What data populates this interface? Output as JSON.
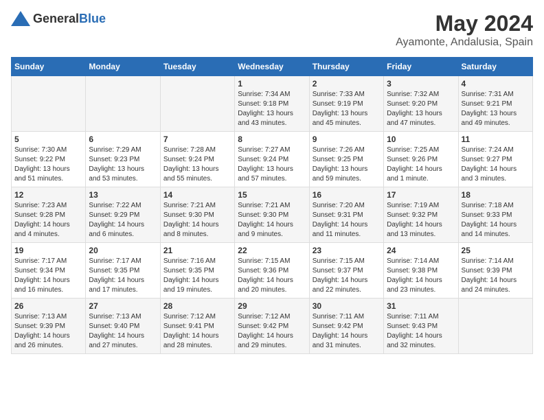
{
  "header": {
    "logo_general": "General",
    "logo_blue": "Blue",
    "title": "May 2024",
    "subtitle": "Ayamonte, Andalusia, Spain"
  },
  "weekdays": [
    "Sunday",
    "Monday",
    "Tuesday",
    "Wednesday",
    "Thursday",
    "Friday",
    "Saturday"
  ],
  "rows": [
    [
      {
        "day": "",
        "sunrise": "",
        "sunset": "",
        "daylight": ""
      },
      {
        "day": "",
        "sunrise": "",
        "sunset": "",
        "daylight": ""
      },
      {
        "day": "",
        "sunrise": "",
        "sunset": "",
        "daylight": ""
      },
      {
        "day": "1",
        "sunrise": "Sunrise: 7:34 AM",
        "sunset": "Sunset: 9:18 PM",
        "daylight": "Daylight: 13 hours and 43 minutes."
      },
      {
        "day": "2",
        "sunrise": "Sunrise: 7:33 AM",
        "sunset": "Sunset: 9:19 PM",
        "daylight": "Daylight: 13 hours and 45 minutes."
      },
      {
        "day": "3",
        "sunrise": "Sunrise: 7:32 AM",
        "sunset": "Sunset: 9:20 PM",
        "daylight": "Daylight: 13 hours and 47 minutes."
      },
      {
        "day": "4",
        "sunrise": "Sunrise: 7:31 AM",
        "sunset": "Sunset: 9:21 PM",
        "daylight": "Daylight: 13 hours and 49 minutes."
      }
    ],
    [
      {
        "day": "5",
        "sunrise": "Sunrise: 7:30 AM",
        "sunset": "Sunset: 9:22 PM",
        "daylight": "Daylight: 13 hours and 51 minutes."
      },
      {
        "day": "6",
        "sunrise": "Sunrise: 7:29 AM",
        "sunset": "Sunset: 9:23 PM",
        "daylight": "Daylight: 13 hours and 53 minutes."
      },
      {
        "day": "7",
        "sunrise": "Sunrise: 7:28 AM",
        "sunset": "Sunset: 9:24 PM",
        "daylight": "Daylight: 13 hours and 55 minutes."
      },
      {
        "day": "8",
        "sunrise": "Sunrise: 7:27 AM",
        "sunset": "Sunset: 9:24 PM",
        "daylight": "Daylight: 13 hours and 57 minutes."
      },
      {
        "day": "9",
        "sunrise": "Sunrise: 7:26 AM",
        "sunset": "Sunset: 9:25 PM",
        "daylight": "Daylight: 13 hours and 59 minutes."
      },
      {
        "day": "10",
        "sunrise": "Sunrise: 7:25 AM",
        "sunset": "Sunset: 9:26 PM",
        "daylight": "Daylight: 14 hours and 1 minute."
      },
      {
        "day": "11",
        "sunrise": "Sunrise: 7:24 AM",
        "sunset": "Sunset: 9:27 PM",
        "daylight": "Daylight: 14 hours and 3 minutes."
      }
    ],
    [
      {
        "day": "12",
        "sunrise": "Sunrise: 7:23 AM",
        "sunset": "Sunset: 9:28 PM",
        "daylight": "Daylight: 14 hours and 4 minutes."
      },
      {
        "day": "13",
        "sunrise": "Sunrise: 7:22 AM",
        "sunset": "Sunset: 9:29 PM",
        "daylight": "Daylight: 14 hours and 6 minutes."
      },
      {
        "day": "14",
        "sunrise": "Sunrise: 7:21 AM",
        "sunset": "Sunset: 9:30 PM",
        "daylight": "Daylight: 14 hours and 8 minutes."
      },
      {
        "day": "15",
        "sunrise": "Sunrise: 7:21 AM",
        "sunset": "Sunset: 9:30 PM",
        "daylight": "Daylight: 14 hours and 9 minutes."
      },
      {
        "day": "16",
        "sunrise": "Sunrise: 7:20 AM",
        "sunset": "Sunset: 9:31 PM",
        "daylight": "Daylight: 14 hours and 11 minutes."
      },
      {
        "day": "17",
        "sunrise": "Sunrise: 7:19 AM",
        "sunset": "Sunset: 9:32 PM",
        "daylight": "Daylight: 14 hours and 13 minutes."
      },
      {
        "day": "18",
        "sunrise": "Sunrise: 7:18 AM",
        "sunset": "Sunset: 9:33 PM",
        "daylight": "Daylight: 14 hours and 14 minutes."
      }
    ],
    [
      {
        "day": "19",
        "sunrise": "Sunrise: 7:17 AM",
        "sunset": "Sunset: 9:34 PM",
        "daylight": "Daylight: 14 hours and 16 minutes."
      },
      {
        "day": "20",
        "sunrise": "Sunrise: 7:17 AM",
        "sunset": "Sunset: 9:35 PM",
        "daylight": "Daylight: 14 hours and 17 minutes."
      },
      {
        "day": "21",
        "sunrise": "Sunrise: 7:16 AM",
        "sunset": "Sunset: 9:35 PM",
        "daylight": "Daylight: 14 hours and 19 minutes."
      },
      {
        "day": "22",
        "sunrise": "Sunrise: 7:15 AM",
        "sunset": "Sunset: 9:36 PM",
        "daylight": "Daylight: 14 hours and 20 minutes."
      },
      {
        "day": "23",
        "sunrise": "Sunrise: 7:15 AM",
        "sunset": "Sunset: 9:37 PM",
        "daylight": "Daylight: 14 hours and 22 minutes."
      },
      {
        "day": "24",
        "sunrise": "Sunrise: 7:14 AM",
        "sunset": "Sunset: 9:38 PM",
        "daylight": "Daylight: 14 hours and 23 minutes."
      },
      {
        "day": "25",
        "sunrise": "Sunrise: 7:14 AM",
        "sunset": "Sunset: 9:39 PM",
        "daylight": "Daylight: 14 hours and 24 minutes."
      }
    ],
    [
      {
        "day": "26",
        "sunrise": "Sunrise: 7:13 AM",
        "sunset": "Sunset: 9:39 PM",
        "daylight": "Daylight: 14 hours and 26 minutes."
      },
      {
        "day": "27",
        "sunrise": "Sunrise: 7:13 AM",
        "sunset": "Sunset: 9:40 PM",
        "daylight": "Daylight: 14 hours and 27 minutes."
      },
      {
        "day": "28",
        "sunrise": "Sunrise: 7:12 AM",
        "sunset": "Sunset: 9:41 PM",
        "daylight": "Daylight: 14 hours and 28 minutes."
      },
      {
        "day": "29",
        "sunrise": "Sunrise: 7:12 AM",
        "sunset": "Sunset: 9:42 PM",
        "daylight": "Daylight: 14 hours and 29 minutes."
      },
      {
        "day": "30",
        "sunrise": "Sunrise: 7:11 AM",
        "sunset": "Sunset: 9:42 PM",
        "daylight": "Daylight: 14 hours and 31 minutes."
      },
      {
        "day": "31",
        "sunrise": "Sunrise: 7:11 AM",
        "sunset": "Sunset: 9:43 PM",
        "daylight": "Daylight: 14 hours and 32 minutes."
      },
      {
        "day": "",
        "sunrise": "",
        "sunset": "",
        "daylight": ""
      }
    ]
  ]
}
